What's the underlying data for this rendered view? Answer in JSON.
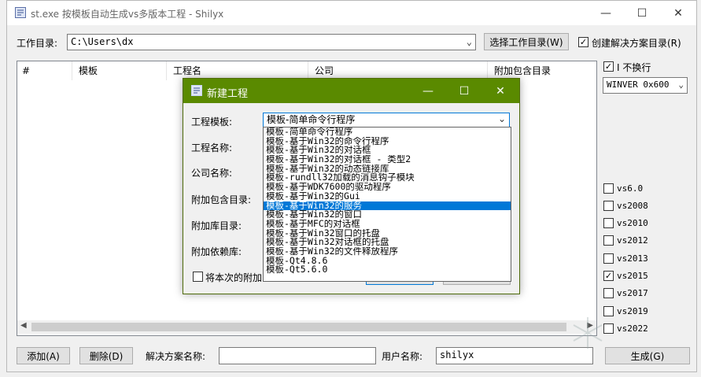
{
  "window": {
    "title": "st.exe 按模板自动生成vs多版本工程 - Shilyx",
    "minimize": "—",
    "maximize": "☐",
    "close": "✕"
  },
  "toolbar": {
    "workdir_label": "工作目录:",
    "workdir_value": "C:\\Users\\dx",
    "choose_dir_button": "选择工作目录(W)",
    "create_solution_dir_label": "创建解决方案目录(R)",
    "create_solution_dir_checked": true
  },
  "list": {
    "columns": [
      "#",
      "模板",
      "工程名",
      "公司",
      "附加包含目录"
    ]
  },
  "right_panel": {
    "no_wrap_label": "不换行",
    "no_wrap_checked": true,
    "winver_value": "WINVER 0x600",
    "vs_versions": [
      {
        "label": "vs6.0",
        "checked": false
      },
      {
        "label": "vs2008",
        "checked": false
      },
      {
        "label": "vs2010",
        "checked": false
      },
      {
        "label": "vs2012",
        "checked": false
      },
      {
        "label": "vs2013",
        "checked": false
      },
      {
        "label": "vs2015",
        "checked": true
      },
      {
        "label": "vs2017",
        "checked": false
      },
      {
        "label": "vs2019",
        "checked": false
      },
      {
        "label": "vs2022",
        "checked": false
      }
    ]
  },
  "bottom": {
    "add_button": "添加(A)",
    "delete_button": "删除(D)",
    "solution_name_label": "解决方案名称:",
    "solution_name_value": "",
    "user_name_label": "用户名称:",
    "user_name_value": "shilyx",
    "generate_button": "生成(G)"
  },
  "dialog": {
    "title": "新建工程",
    "template_label": "工程模板:",
    "template_value": "模板-简单命令行程序",
    "project_name_label": "工程名称:",
    "company_name_label": "公司名称:",
    "include_dir_label": "附加包含目录:",
    "lib_dir_label": "附加库目录:",
    "dependency_label": "附加依赖库:",
    "remember_label": "将本次的附加",
    "template_options": [
      "模板-简单命令行程序",
      "模板-基于Win32的命令行程序",
      "模板-基于Win32的对话框",
      "模板-基于Win32的对话框 - 类型2",
      "模板-基于Win32的动态链接库",
      "模板-rundll32加载的消息钩子模块",
      "模板-基于WDK7600的驱动程序",
      "模板-基于Win32的Gui",
      "模板-基于Win32的服务",
      "模板-基于Win32的窗口",
      "模板-基于MFC的对话框",
      "模板-基于Win32窗口的托盘",
      "模板-基于Win32对话框的托盘",
      "模板-基于Win32的文件释放程序",
      "模板-Qt4.8.6",
      "模板-Qt5.6.0"
    ],
    "selected_index": 8
  },
  "colors": {
    "dialog_title_bg": "#5a8a00",
    "selection": "#0078d7"
  }
}
